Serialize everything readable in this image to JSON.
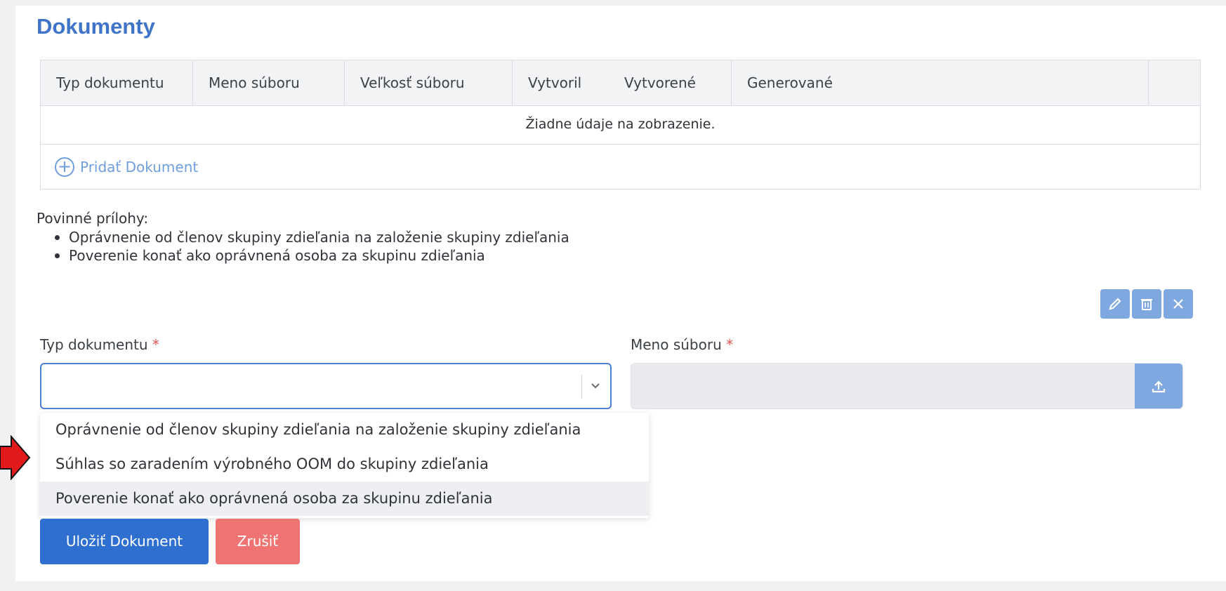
{
  "section": {
    "title": "Dokumenty"
  },
  "grid": {
    "columns": [
      "Typ dokumentu",
      "Meno súboru",
      "Veľkosť súboru",
      "Vytvoril",
      "Vytvorené",
      "Generované"
    ],
    "empty_text": "Žiadne údaje na zobrazenie.",
    "add_label": "Pridať Dokument"
  },
  "required": {
    "title": "Povinné prílohy:",
    "items": [
      "Oprávnenie od členov skupiny zdieľania na založenie skupiny zdieľania",
      "Poverenie konať ako oprávnená osoba za skupinu zdieľania"
    ]
  },
  "form": {
    "type_label": "Typ dokumentu",
    "file_label": "Meno súboru",
    "required_mark": "*",
    "type_value": "",
    "file_value": ""
  },
  "dropdown": {
    "options": [
      "Oprávnenie od členov skupiny zdieľania na založenie skupiny zdieľania",
      "Súhlas so zaradením výrobného OOM do skupiny zdieľania",
      "Poverenie konať ako oprávnená osoba za skupinu zdieľania"
    ],
    "hovered_index": 2
  },
  "buttons": {
    "save": "Uložiť Dokument",
    "cancel": "Zrušiť"
  },
  "icons": [
    "pencil-icon",
    "trash-icon",
    "close-icon",
    "chevron-down-icon",
    "upload-icon",
    "plus-circle-icon",
    "red-arrow-pointer"
  ],
  "colors": {
    "accent": "#3f74c8",
    "primary_button": "#2f6fcf",
    "cancel_button": "#f07373",
    "action_button": "#7fa7e0",
    "required_mark": "#e25555"
  }
}
